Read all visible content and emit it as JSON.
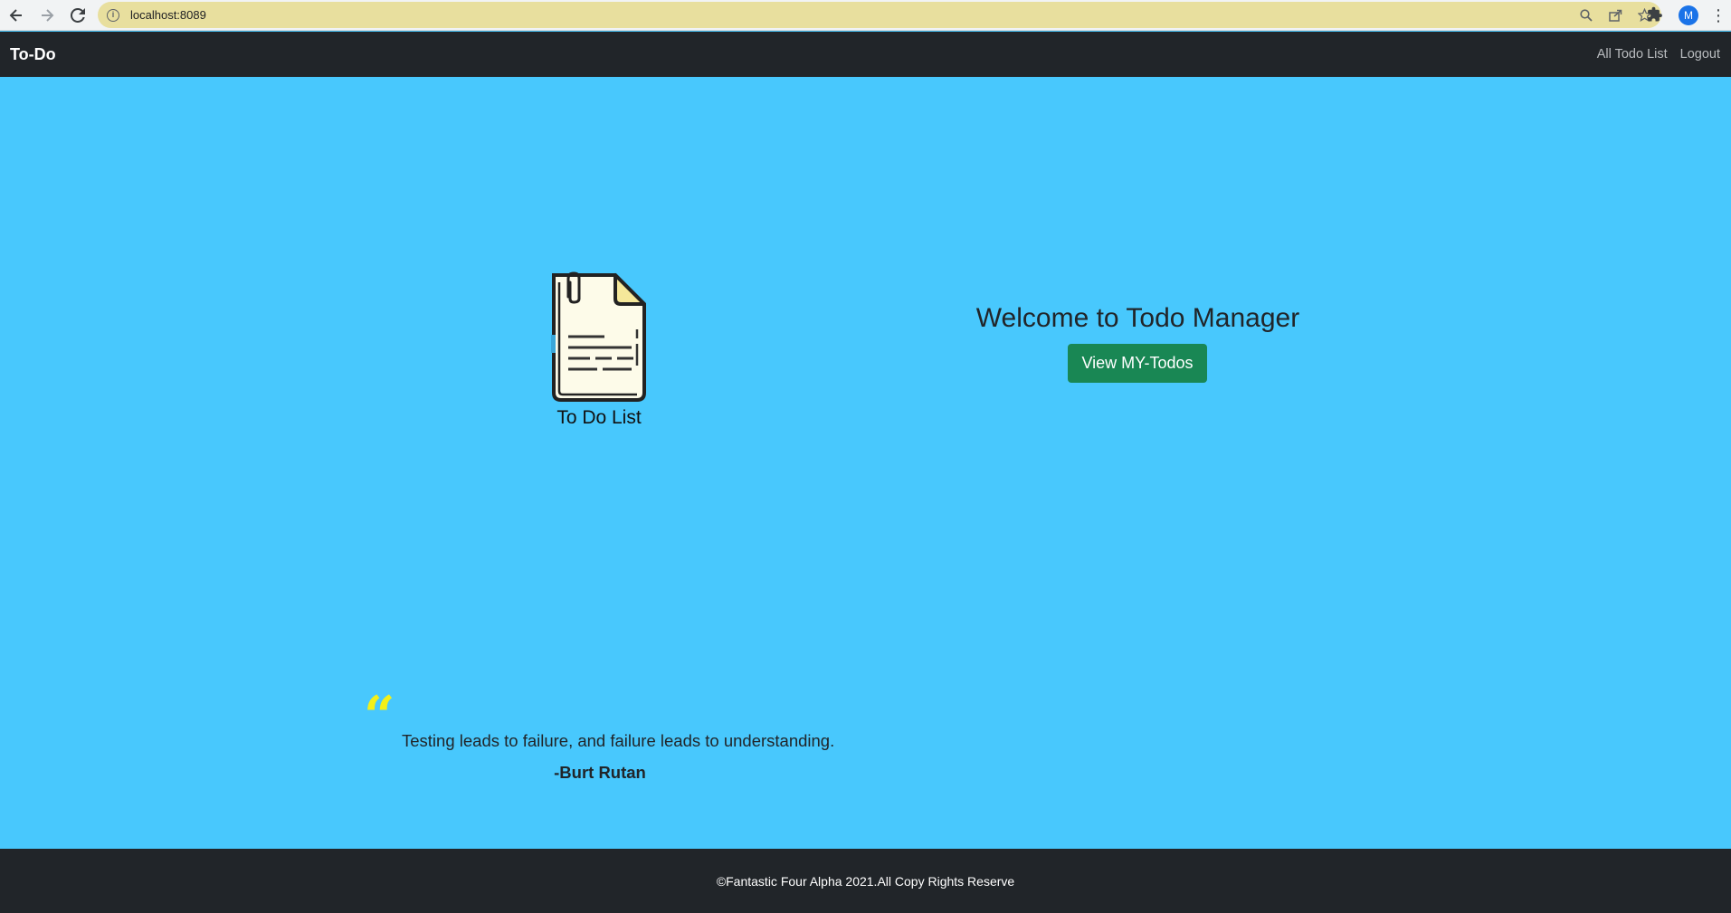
{
  "browser": {
    "url": "localhost:8089",
    "profile_initial": "M",
    "icons": [
      "back-arrow-icon",
      "forward-arrow-icon",
      "reload-icon",
      "info-icon",
      "zoom-icon",
      "share-icon",
      "star-icon",
      "extensions-icon",
      "kebab-menu-icon"
    ]
  },
  "navbar": {
    "brand": "To-Do",
    "links": [
      "All Todo List",
      "Logout"
    ]
  },
  "hero": {
    "logo_label": "To Do List",
    "title": "Welcome to Todo Manager",
    "button_label": "View MY-Todos"
  },
  "quote": {
    "mark": "“",
    "text": "Testing leads to failure, and failure leads to understanding.",
    "author": "-Burt Rutan"
  },
  "footer": {
    "text": "©Fantastic Four Alpha 2021.All Copy Rights Reserve"
  },
  "colors": {
    "page_background": "#48c8fd",
    "navbar_background": "#212529",
    "button_green": "#198754",
    "quote_mark_yellow": "#f3f018",
    "omnibox_background": "#e8df9e"
  }
}
